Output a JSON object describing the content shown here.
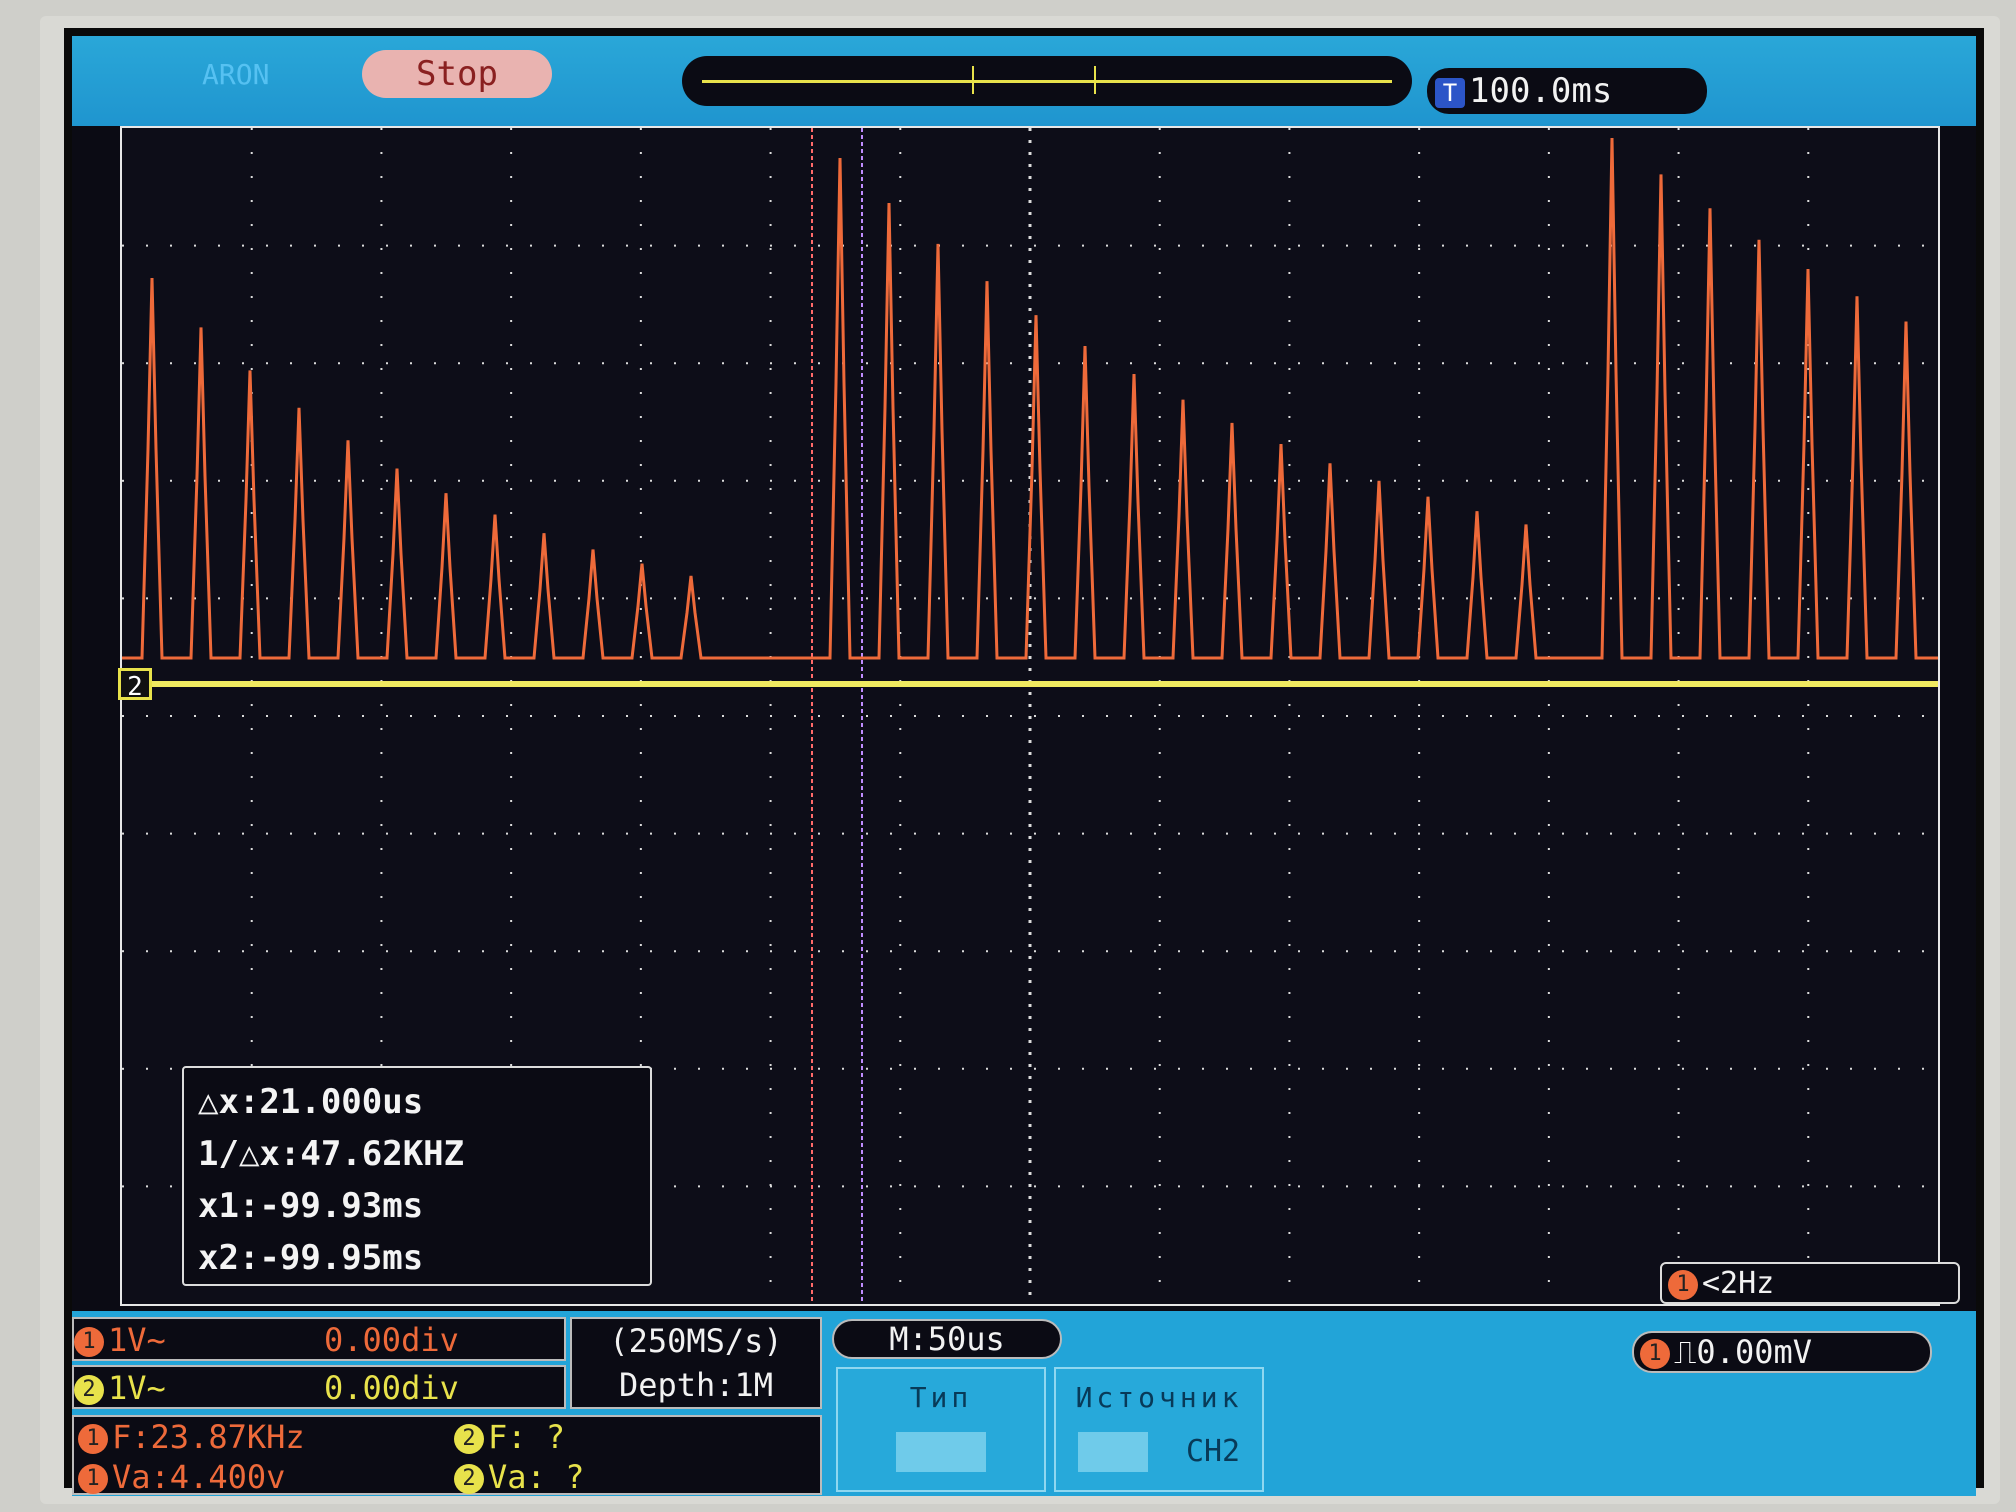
{
  "header": {
    "run_state": "ARON",
    "stop_label": "Stop",
    "trigger_offset": "100.0ms",
    "trigger_icon": "T"
  },
  "plot": {
    "ch2_marker": "2",
    "colors": {
      "ch1": "#ee6a3a",
      "ch2": "#e8e24b",
      "grid": "#e8e8e8",
      "cursor": "#ff5a5a"
    }
  },
  "cursor_panel": {
    "dx": "△x:21.000us",
    "inv_dx": "1/△x:47.62KHZ",
    "x1": "x1:-99.93ms",
    "x2": "x2:-99.95ms"
  },
  "freq_counter": {
    "channel": "1",
    "value": "<2Hz"
  },
  "status": {
    "ch1": {
      "channel": "1",
      "scale": "1V~",
      "offset": "0.00div"
    },
    "ch2": {
      "channel": "2",
      "scale": "1V~",
      "offset": "0.00div"
    },
    "sample_rate": "(250MS/s)",
    "depth": "Depth:1M",
    "timebase": "M:50us",
    "trigger_channel": "1",
    "trigger_level": "0.00mV",
    "measure": {
      "ch1_freq": "F:23.87KHz",
      "ch1_va": "Va:4.400v",
      "ch2_freq": "F:  ?",
      "ch2_va": "Va:  ?"
    }
  },
  "menu": {
    "type_label": "Тип",
    "source_label": "Источник",
    "source_value": "CH2"
  }
}
